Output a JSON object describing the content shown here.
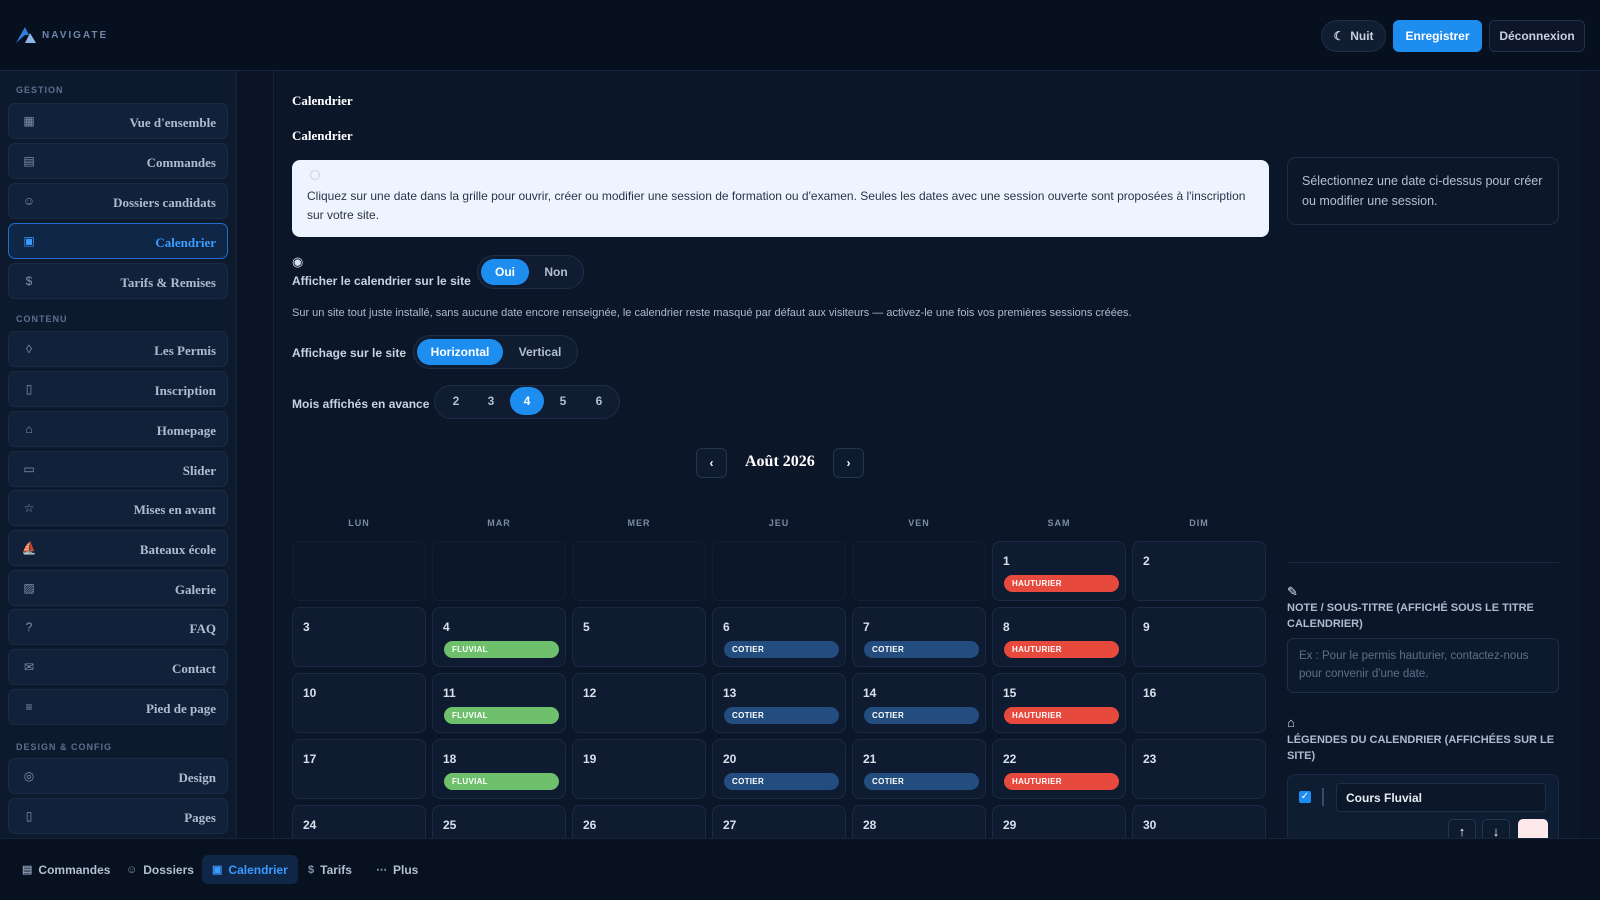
{
  "brand": {
    "name": "NAVIGATE",
    "accent": "#1e8df0"
  },
  "topbar": {
    "night_label": "Nuit",
    "save_label": "Enregistrer",
    "logout_label": "Déconnexion"
  },
  "sidebar": {
    "sections": [
      {
        "title": "GESTION"
      },
      {
        "title": "CONTENU"
      },
      {
        "title": "DESIGN & CONFIG"
      }
    ],
    "items": [
      {
        "label": "Vue d'ensemble",
        "icon": "grid-icon"
      },
      {
        "label": "Commandes",
        "icon": "inbox-icon"
      },
      {
        "label": "Dossiers candidats",
        "icon": "users-icon"
      },
      {
        "label": "Calendrier",
        "icon": "calendar-icon",
        "active": true
      },
      {
        "label": "Tarifs & Remises",
        "icon": "dollar-icon"
      },
      {
        "label": "Les Permis",
        "icon": "shield-icon"
      },
      {
        "label": "Inscription",
        "icon": "document-icon"
      },
      {
        "label": "Homepage",
        "icon": "home-icon"
      },
      {
        "label": "Slider",
        "icon": "slider-icon"
      },
      {
        "label": "Mises en avant",
        "icon": "star-icon"
      },
      {
        "label": "Bateaux école",
        "icon": "boat-icon"
      },
      {
        "label": "Galerie",
        "icon": "image-icon"
      },
      {
        "label": "FAQ",
        "icon": "help-icon"
      },
      {
        "label": "Contact",
        "icon": "mail-icon"
      },
      {
        "label": "Pied de page",
        "icon": "menu-icon"
      },
      {
        "label": "Design",
        "icon": "palette-icon"
      },
      {
        "label": "Pages",
        "icon": "page-icon"
      }
    ]
  },
  "main": {
    "title": "Calendrier",
    "subtitle": "Calendrier",
    "info_text": "Cliquez sur une date dans la grille pour ouvrir, créer ou modifier une session de formation ou d'examen. Seules les dates avec une session ouverte sont proposées à l'inscription sur votre site.",
    "side_hint": "Sélectionnez une date ci-dessus pour créer ou modifier une session.",
    "show_label": "Afficher le calendrier sur le site",
    "show_options": [
      "Oui",
      "Non"
    ],
    "show_value": "Oui",
    "hint": "Sur un site tout juste installé, sans aucune date encore renseignée, le calendrier reste masqué par défaut aux visiteurs — activez-le une fois vos premières sessions créées.",
    "display_label": "Affichage sur le site",
    "display_options": [
      "Horizontal",
      "Vertical"
    ],
    "display_value": "Horizontal",
    "months_label": "Mois affichés en avance",
    "months_options": [
      "2",
      "3",
      "4",
      "5",
      "6"
    ],
    "months_value": "4",
    "prev": "‹",
    "next": "›"
  },
  "calendar": {
    "month": "Août 2026",
    "weekdays": [
      "LUN",
      "MAR",
      "MER",
      "JEU",
      "VEN",
      "SAM",
      "DIM"
    ],
    "leading_blanks": 5,
    "days": [
      {
        "d": "1",
        "tag": "HAUTURIER"
      },
      {
        "d": "2"
      },
      {
        "d": "3"
      },
      {
        "d": "4",
        "tag": "FLUVIAL"
      },
      {
        "d": "5"
      },
      {
        "d": "6",
        "tag": "COTIER"
      },
      {
        "d": "7",
        "tag": "COTIER"
      },
      {
        "d": "8",
        "tag": "HAUTURIER"
      },
      {
        "d": "9"
      },
      {
        "d": "10"
      },
      {
        "d": "11",
        "tag": "FLUVIAL"
      },
      {
        "d": "12"
      },
      {
        "d": "13",
        "tag": "COTIER"
      },
      {
        "d": "14",
        "tag": "COTIER"
      },
      {
        "d": "15",
        "tag": "HAUTURIER"
      },
      {
        "d": "16"
      },
      {
        "d": "17"
      },
      {
        "d": "18",
        "tag": "FLUVIAL"
      },
      {
        "d": "19"
      },
      {
        "d": "20",
        "tag": "COTIER"
      },
      {
        "d": "21",
        "tag": "COTIER"
      },
      {
        "d": "22",
        "tag": "HAUTURIER"
      },
      {
        "d": "23"
      },
      {
        "d": "24"
      },
      {
        "d": "25"
      },
      {
        "d": "26"
      },
      {
        "d": "27"
      },
      {
        "d": "28"
      },
      {
        "d": "29"
      },
      {
        "d": "30"
      }
    ],
    "tag_colors": {
      "HAUTURIER": "#e8493d",
      "FLUVIAL": "#6fc06c",
      "COTIER": "#234d7e"
    }
  },
  "note": {
    "label": "NOTE / SOUS-TITRE (AFFICHÉ SOUS LE TITRE CALENDRIER)",
    "placeholder": "Ex : Pour le permis hauturier, contactez-nous pour convenir d'une date."
  },
  "legends": {
    "label": "LÉGENDES DU CALENDRIER (AFFICHÉES SUR LE SITE)",
    "items": [
      {
        "name": "Cours Fluvial",
        "checked": true,
        "color": "#fde9ea"
      }
    ]
  },
  "bottombar": {
    "items": [
      {
        "label": "Commandes",
        "icon": "inbox-icon"
      },
      {
        "label": "Dossiers",
        "icon": "users-icon"
      },
      {
        "label": "Calendrier",
        "icon": "calendar-icon",
        "active": true
      },
      {
        "label": "Tarifs",
        "icon": "dollar-icon"
      },
      {
        "label": "Plus",
        "icon": "more-icon"
      }
    ]
  }
}
